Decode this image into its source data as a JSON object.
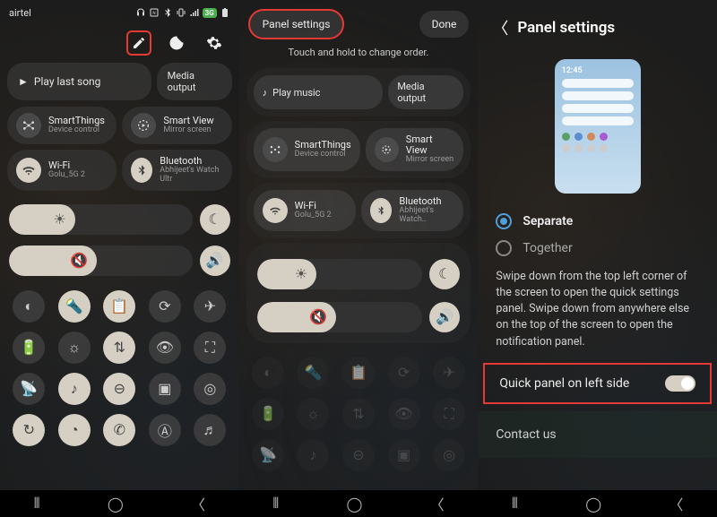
{
  "panel1": {
    "carrier": "airtel",
    "badge": "3G",
    "play_last": "Play last song",
    "media_output": "Media output",
    "smartthings": {
      "title": "SmartThings",
      "sub": "Device control"
    },
    "smartview": {
      "title": "Smart View",
      "sub": "Mirror screen"
    },
    "wifi": {
      "title": "Wi-Fi",
      "sub": "Golu_5G 2"
    },
    "bluetooth": {
      "title": "Bluetooth",
      "sub": "Abhijeet's Watch Ultr"
    }
  },
  "panel2": {
    "panel_settings": "Panel settings",
    "done": "Done",
    "subtitle": "Touch and hold to change order.",
    "play_music": "Play music",
    "media_output": "Media output",
    "smartthings": {
      "title": "SmartThings",
      "sub": "Device control"
    },
    "smartview": {
      "title": "Smart View",
      "sub": "Mirror screen"
    },
    "wifi": {
      "title": "Wi-Fi",
      "sub": "Golu_5G 2"
    },
    "bluetooth": {
      "title": "Bluetooth",
      "sub": "Abhijeet's Watch.."
    }
  },
  "panel3": {
    "title": "Panel settings",
    "preview_time": "12:45",
    "opt_separate": "Separate",
    "opt_together": "Together",
    "description": "Swipe down from the top left corner of the screen to open the quick settings panel. Swipe down from anywhere else on the top of the screen to open the notification panel.",
    "toggle_label": "Quick panel on left side",
    "contact": "Contact us"
  }
}
